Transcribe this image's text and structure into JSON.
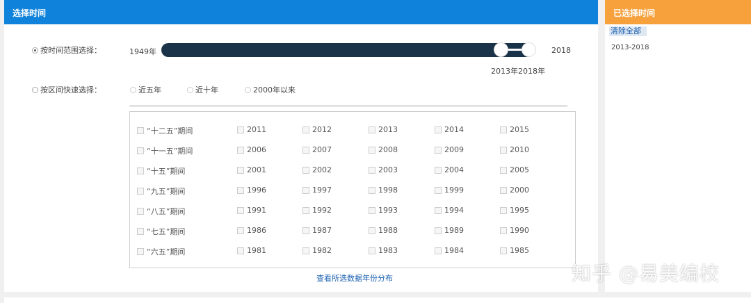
{
  "main": {
    "title": "选择时间",
    "range_option": {
      "label": "按时间范围选择：",
      "checked": true
    },
    "slider": {
      "min_label": "1949年",
      "max_label": "2018",
      "selected_start": "2013年",
      "selected_end": "2018年"
    },
    "quick_option": {
      "label": "按区间快速选择：",
      "checked": false
    },
    "quick_choices": [
      "近五年",
      "近十年",
      "2000年以来"
    ],
    "grid_rows": [
      {
        "period": "“十二五”期间",
        "years": [
          "2011",
          "2012",
          "2013",
          "2014",
          "2015"
        ]
      },
      {
        "period": "“十一五”期间",
        "years": [
          "2006",
          "2007",
          "2008",
          "2009",
          "2010"
        ]
      },
      {
        "period": "“十五”期间",
        "years": [
          "2001",
          "2002",
          "2003",
          "2004",
          "2005"
        ]
      },
      {
        "period": "“九五”期间",
        "years": [
          "1996",
          "1997",
          "1998",
          "1999",
          "2000"
        ]
      },
      {
        "period": "“八五”期间",
        "years": [
          "1991",
          "1992",
          "1993",
          "1994",
          "1995"
        ]
      },
      {
        "period": "“七五”期间",
        "years": [
          "1986",
          "1987",
          "1988",
          "1989",
          "1990"
        ]
      },
      {
        "period": "“六五”期间",
        "years": [
          "1981",
          "1982",
          "1983",
          "1984",
          "1985"
        ]
      }
    ],
    "view_link": "查看所选数据年份分布"
  },
  "side": {
    "title": "已选择时间",
    "clear_all": "清除全部",
    "selected": "2013-2018"
  },
  "watermark": "知乎 @易美编校",
  "colors": {
    "main_header": "#0f82db",
    "side_header": "#f7a13d",
    "slider": "#1a3349"
  }
}
